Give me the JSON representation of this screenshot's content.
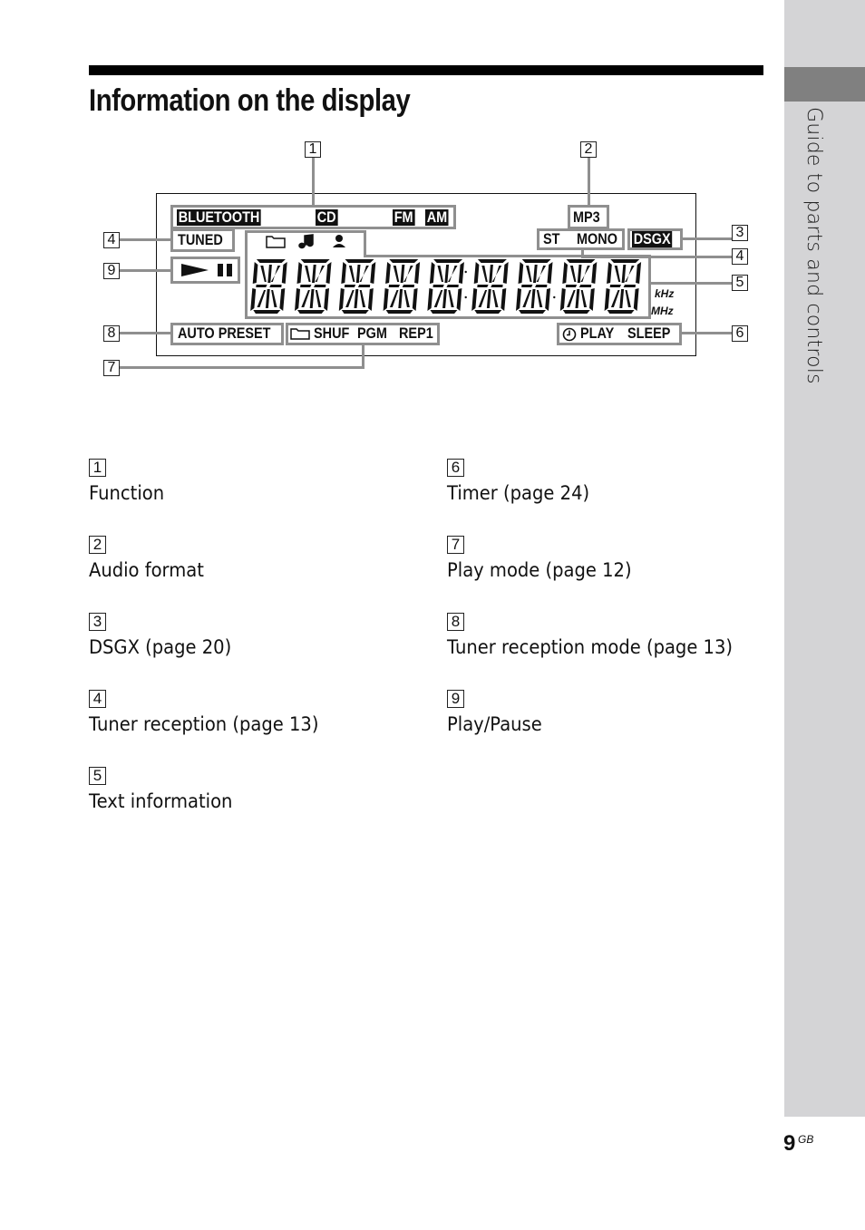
{
  "sidebar": {
    "section_title": "Guide to parts and controls"
  },
  "page": {
    "title": "Information on the display",
    "number": "9",
    "suffix": "GB"
  },
  "display": {
    "function_indicators": [
      "BLUETOOTH",
      "CD",
      "FM",
      "AM"
    ],
    "tuned": "TUNED",
    "audio_format": "MP3",
    "reception": [
      "ST",
      "MONO"
    ],
    "dsgx": "DSGX",
    "play_pause_icons": [
      "play-icon",
      "pause-icon"
    ],
    "text_icons": [
      "folder-icon",
      "music-note-icon",
      "artist-icon"
    ],
    "segment_digits": 9,
    "units": [
      "kHz",
      "MHz"
    ],
    "auto_preset": "AUTO PRESET",
    "play_mode": {
      "icon": "folder-icon",
      "labels": [
        "SHUF",
        "PGM",
        "REP1"
      ]
    },
    "timer": {
      "icon": "clock-icon",
      "labels": [
        "PLAY",
        "SLEEP"
      ]
    },
    "callouts": {
      "c1": "1",
      "c2": "2",
      "c3": "3",
      "c4a": "4",
      "c4b": "4",
      "c5": "5",
      "c6": "6",
      "c7": "7",
      "c8": "8",
      "c9": "9"
    }
  },
  "legend": [
    {
      "num": "1",
      "label": "Function"
    },
    {
      "num": "2",
      "label": "Audio format"
    },
    {
      "num": "3",
      "label": "DSGX (page 20)"
    },
    {
      "num": "4",
      "label": "Tuner reception (page 13)"
    },
    {
      "num": "5",
      "label": "Text information"
    },
    {
      "num": "6",
      "label": "Timer (page 24)"
    },
    {
      "num": "7",
      "label": "Play mode (page 12)"
    },
    {
      "num": "8",
      "label": "Tuner reception mode (page 13)"
    },
    {
      "num": "9",
      "label": "Play/Pause"
    }
  ]
}
